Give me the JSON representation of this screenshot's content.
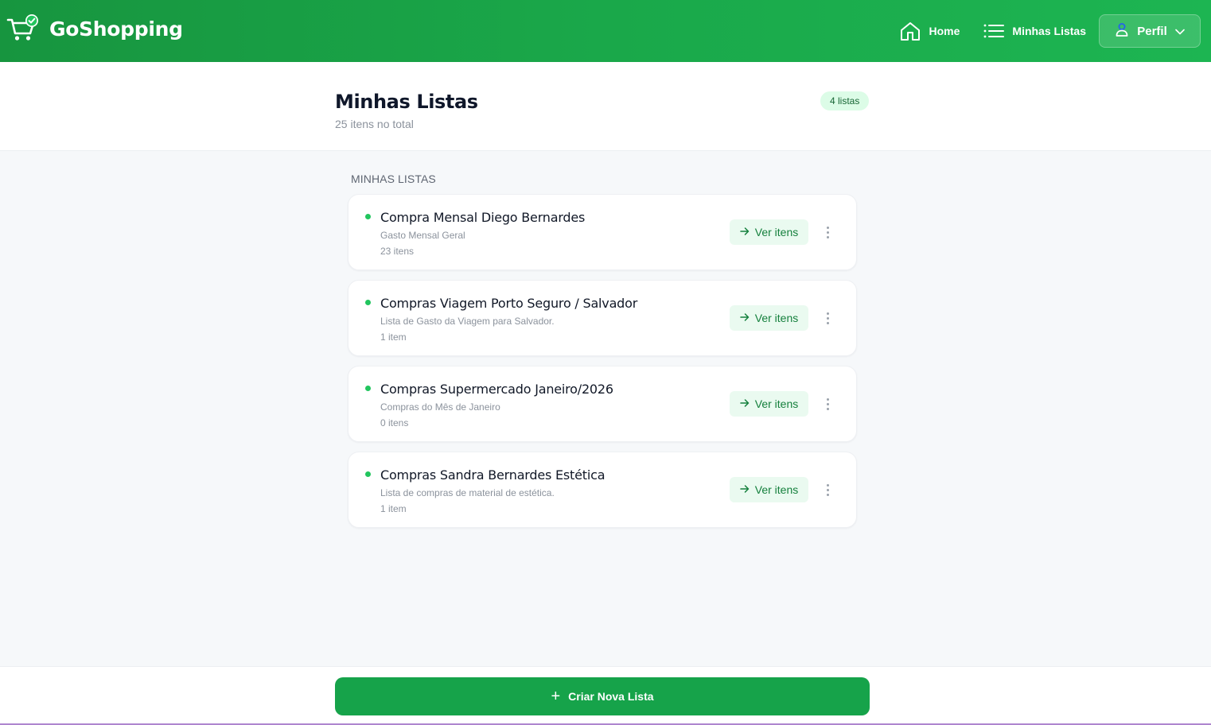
{
  "header": {
    "brand": "GoShopping",
    "brand_icon": "cart-check-icon",
    "nav": [
      {
        "label": "Home",
        "icon": "home-icon"
      },
      {
        "label": "Minhas Listas",
        "icon": "list-icon"
      }
    ],
    "profile_label": "Perfil",
    "colors": {
      "bar_start": "#17953f",
      "bar_end": "#1db552"
    }
  },
  "page": {
    "title": "Minhas Listas",
    "subtitle": "25 itens no total",
    "badge": "4 listas",
    "section_label": "MINHAS LISTAS"
  },
  "lists": [
    {
      "title": "Compra Mensal Diego Bernardes",
      "description": "Gasto Mensal Geral",
      "count": "23 itens",
      "action": "Ver itens"
    },
    {
      "title": "Compras Viagem Porto Seguro / Salvador",
      "description": "Lista de Gasto da Viagem para Salvador.",
      "count": "1 item",
      "action": "Ver itens"
    },
    {
      "title": "Compras Supermercado Janeiro/2026",
      "description": "Compras do Mês de Janeiro",
      "count": "0 itens",
      "action": "Ver itens"
    },
    {
      "title": "Compras Sandra Bernardes Estética",
      "description": "Lista de compras de material de estética.",
      "count": "1 item",
      "action": "Ver itens"
    }
  ],
  "footer": {
    "create_label": "Criar Nova Lista",
    "create_icon": "plus-icon",
    "accent": "#16a34a"
  }
}
